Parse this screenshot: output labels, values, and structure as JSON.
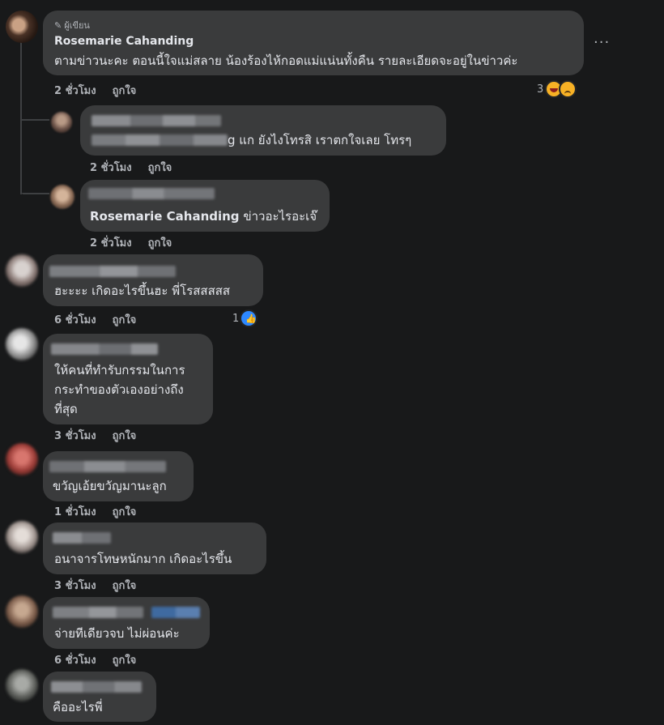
{
  "comments": [
    {
      "author_badge": "ผู้เขียน",
      "author": "Rosemarie Cahanding",
      "text": "ตามข่าวนะคะ ตอนนี้ใจแม่สลาย น้องร้องไห้กอดแม่แน่นทั้งคืน รายละเอียดจะอยู่ในข่าวค่ะ",
      "time": "2 ชั่วโมง",
      "like": "ถูกใจ",
      "reaction_count": "3",
      "reactions": [
        "haha-icon",
        "sad-icon"
      ]
    },
    {
      "text_suffix": "g แก ยังไงโทรสิ เราตกใจเลย โทรๆ",
      "time": "2 ชั่วโมง",
      "like": "ถูกใจ"
    },
    {
      "mention": "Rosemarie Cahanding",
      "text": "ข่าวอะไรอะเจ๊",
      "time": "2 ชั่วโมง",
      "like": "ถูกใจ"
    },
    {
      "text": "ฮะะะะ เกิดอะไรขึ้นฮะ พี่โรสสสสส",
      "time": "6 ชั่วโมง",
      "like": "ถูกใจ",
      "reaction_count": "1",
      "reactions": [
        "like-icon"
      ]
    },
    {
      "text_lines": [
        "ให้คนที่ทำรับกรรมในการ",
        "กระทำของตัวเองอย่างถึง",
        "ที่สุด"
      ],
      "time": "3 ชั่วโมง",
      "like": "ถูกใจ"
    },
    {
      "text": "ขวัญเอ้ยขวัญมานะลูก",
      "time": "1 ชั่วโมง",
      "like": "ถูกใจ"
    },
    {
      "text": "อนาจารโทษหนักมาก เกิดอะไรขึ้น",
      "time": "3 ชั่วโมง",
      "like": "ถูกใจ"
    },
    {
      "text": "จ่ายทีเดียวจบ ไม่ผ่อนค่ะ",
      "time": "6 ชั่วโมง",
      "like": "ถูกใจ"
    },
    {
      "text": "คืออะไรพี่"
    }
  ],
  "more_label": "···",
  "colors": {
    "background": "#18191a",
    "bubble": "#3a3b3c",
    "meta_text": "#b0b3b8",
    "like_blue": "#2d88ff"
  }
}
